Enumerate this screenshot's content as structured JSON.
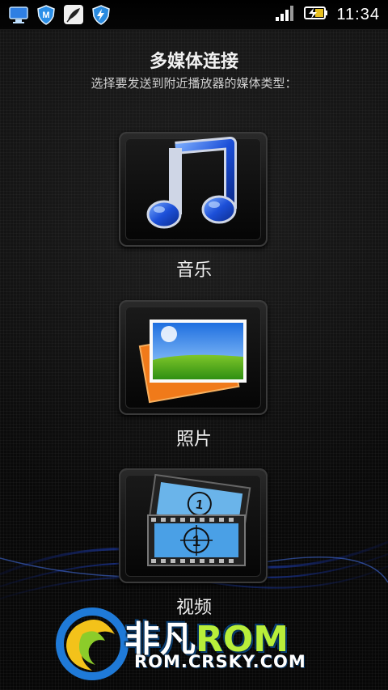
{
  "status_bar": {
    "time": "11:34",
    "left_icons": [
      "monitor-icon",
      "shield-m-icon",
      "feather-icon",
      "lightning-shield-icon"
    ],
    "right_icons": [
      "signal-icon",
      "battery-charging-icon"
    ]
  },
  "header": {
    "title": "多媒体连接",
    "subtitle": "选择要发送到附近播放器的媒体类型："
  },
  "media_types": [
    {
      "label": "音乐",
      "icon": "music-note-icon"
    },
    {
      "label": "照片",
      "icon": "photos-icon"
    },
    {
      "label": "视频",
      "icon": "film-strip-icon"
    }
  ],
  "watermark": {
    "brand_cn": "非凡",
    "brand_en": "ROM",
    "url": "ROM.CRSKY.COM"
  },
  "colors": {
    "background": "#0b0b0b",
    "text": "#f2f2f2",
    "accent_blue": "#1e6fe0"
  }
}
